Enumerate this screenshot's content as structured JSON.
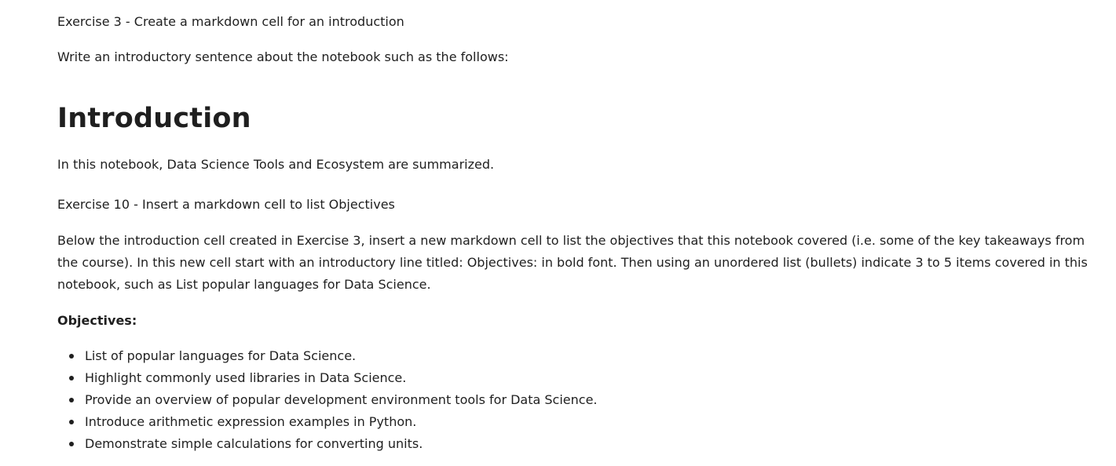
{
  "exercise3": {
    "title": "Exercise 3 - Create a markdown cell for an introduction",
    "instruction": "Write an introductory sentence about the notebook such as the follows:"
  },
  "introduction": {
    "heading": "Introduction",
    "text": "In this notebook, Data Science Tools and Ecosystem are summarized."
  },
  "exercise10": {
    "title": "Exercise 10 - Insert a markdown cell to list Objectives",
    "instruction": "Below the introduction cell created in Exercise 3, insert a new markdown cell to list the objectives that this notebook covered (i.e. some of the key takeaways from the course). In this new cell start with an introductory line titled: Objectives: in bold font. Then using an unordered list (bullets) indicate 3 to 5 items covered in this notebook, such as List popular languages for Data Science."
  },
  "objectives": {
    "label": "Objectives:",
    "items": [
      "List of popular languages for Data Science.",
      "Highlight commonly used libraries in Data Science.",
      "Provide an overview of popular development environment tools for Data Science.",
      "Introduce arithmetic expression examples in Python.",
      "Demonstrate simple calculations for converting units."
    ]
  }
}
